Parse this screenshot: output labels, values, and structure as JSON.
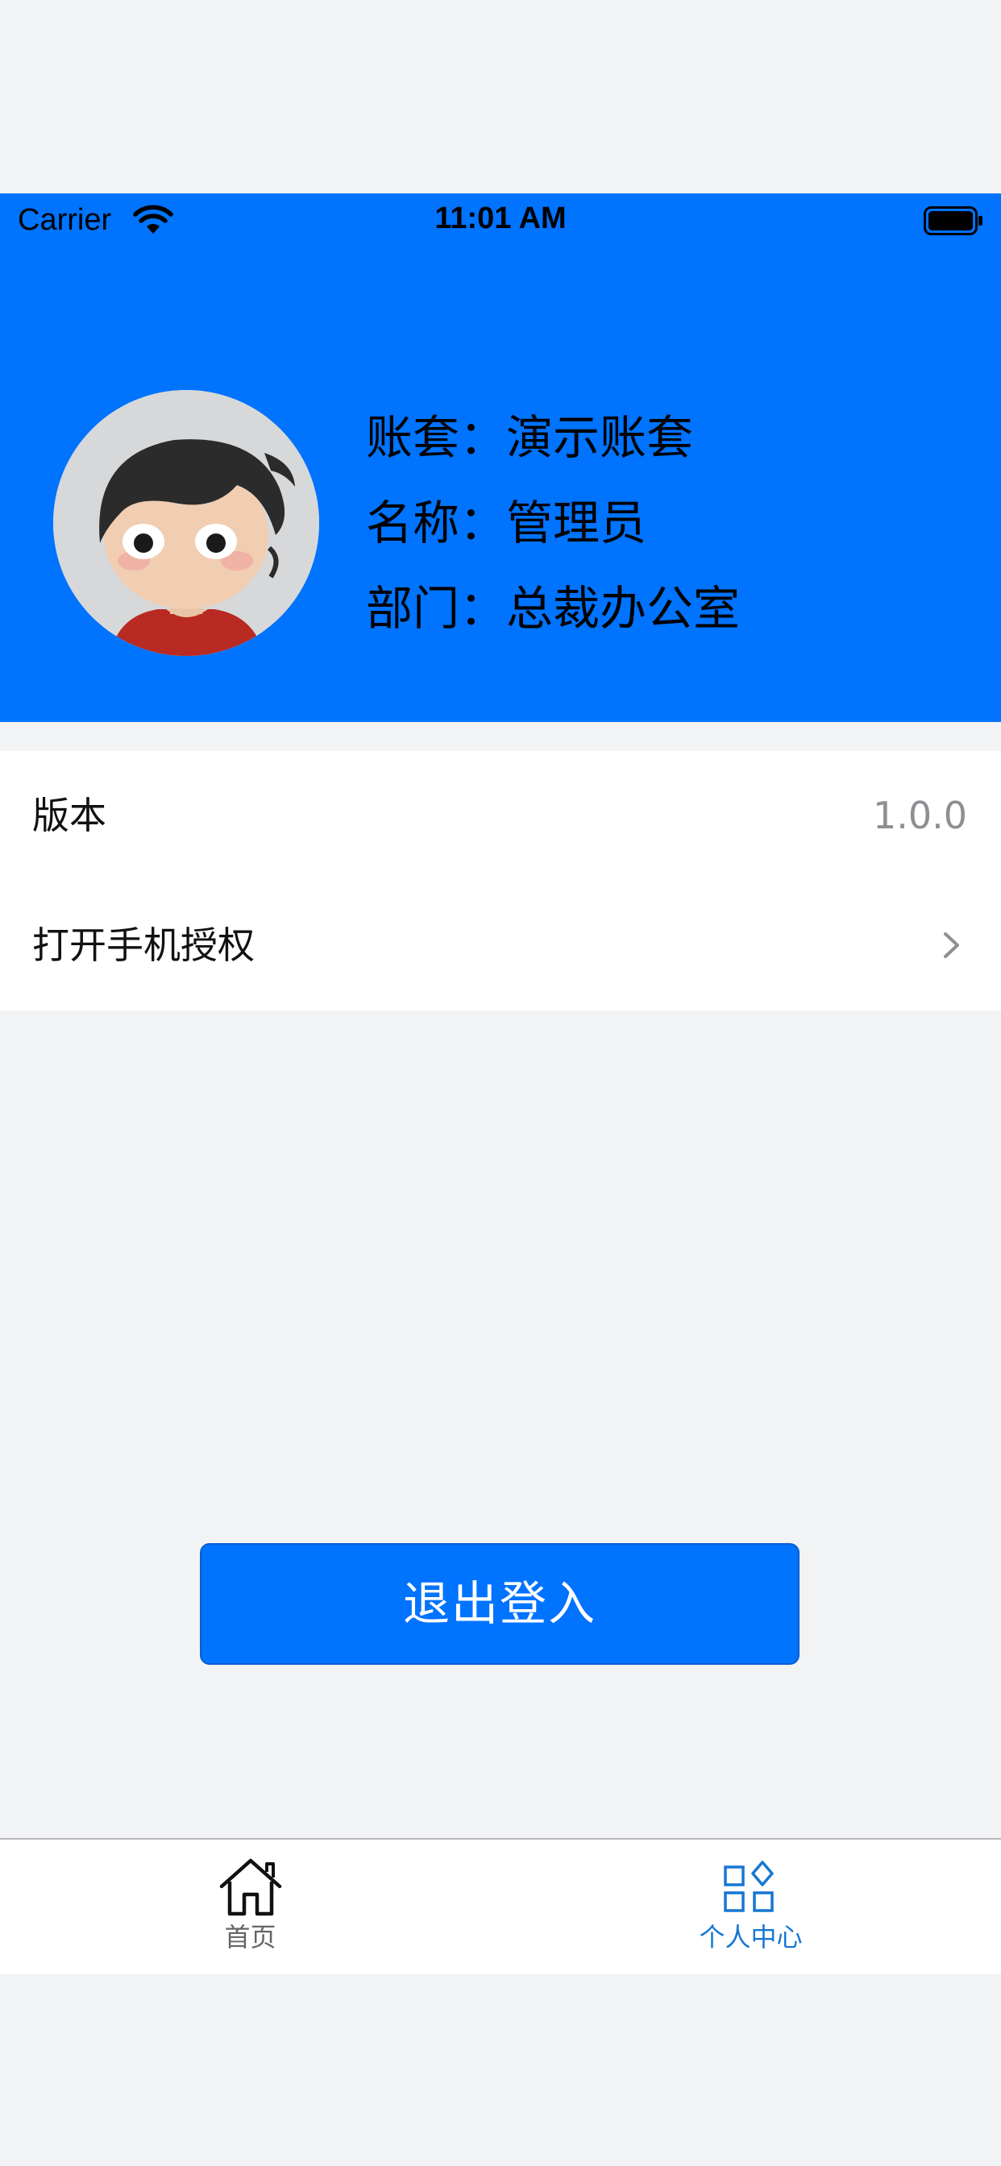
{
  "status_bar": {
    "carrier": "Carrier",
    "time": "11:01 AM"
  },
  "profile": {
    "rows": [
      {
        "label": "账套：",
        "value": "演示账套"
      },
      {
        "label": "名称：",
        "value": "管理员"
      },
      {
        "label": "部门：",
        "value": "总裁办公室"
      }
    ]
  },
  "settings": {
    "version_label": "版本",
    "version_value": "1.0.0",
    "permission_label": "打开手机授权"
  },
  "logout_label": "退出登入",
  "tabbar": {
    "home_label": "首页",
    "profile_label": "个人中心",
    "active_tab": "个人中心"
  },
  "colors": {
    "header": "#0073ff",
    "button": "#0073ff",
    "active_tab": "#1677d2",
    "inactive_tab": "#666666",
    "background": "#f2f3f5"
  }
}
